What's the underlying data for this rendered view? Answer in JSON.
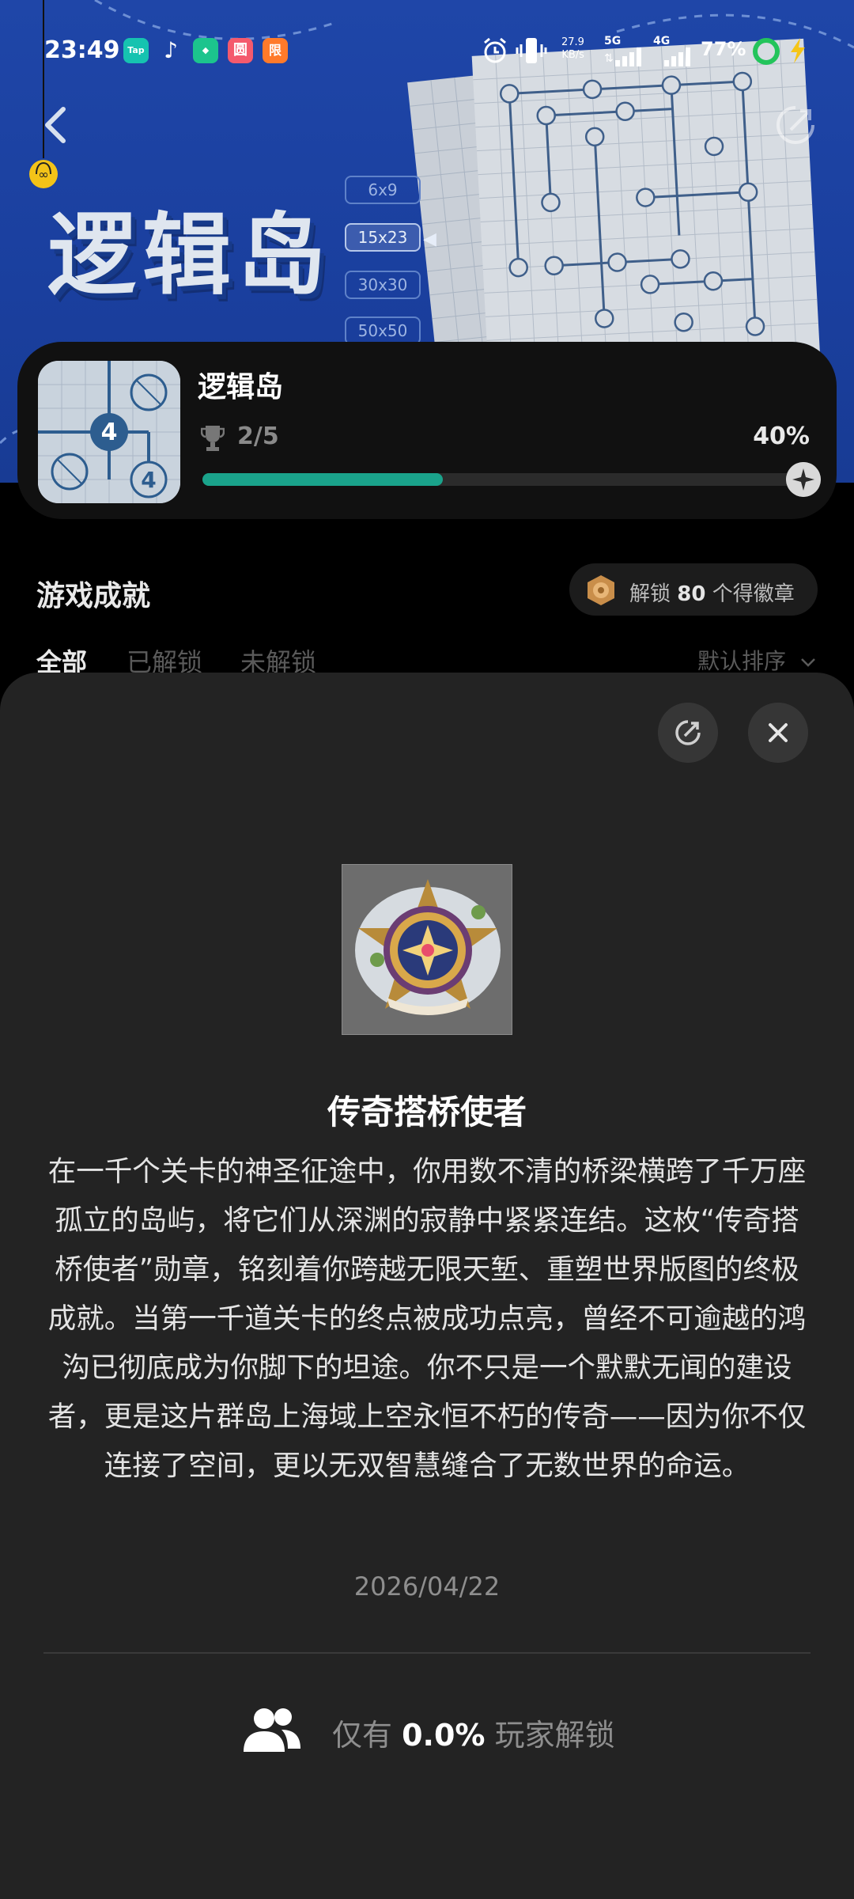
{
  "status_bar": {
    "time": "23:49",
    "apps": [
      {
        "name": "tap-app-icon",
        "label": "Tap",
        "color": "#16c3b0"
      },
      {
        "name": "tiktok-icon",
        "label": "♪",
        "color": "transparent"
      },
      {
        "name": "shield-app-icon",
        "label": "◆",
        "color": "#1cc48d"
      },
      {
        "name": "photo-app-icon",
        "label": "圆",
        "color": "#f45a6d"
      },
      {
        "name": "flash-sale-icon",
        "label": "限",
        "color": "#ff7a2a"
      }
    ],
    "net_speed_value": "27.9",
    "net_speed_unit": "KB/s",
    "sim1": "5G",
    "sim2": "4G",
    "battery": "77%"
  },
  "banner": {
    "title": "逻辑岛",
    "sizes": [
      "6x9",
      "15x23",
      "30x30",
      "50x50"
    ],
    "active_size": "15x23"
  },
  "game_card": {
    "name": "逻辑岛",
    "count": "2/5",
    "percent": "40%",
    "progress": 0.4,
    "thumb_number": "4"
  },
  "achievements": {
    "title": "游戏成就",
    "badge_pill_prefix": "解锁 ",
    "badge_pill_count": "80",
    "badge_pill_suffix": " 个得徽章",
    "tabs": [
      "全部",
      "已解锁",
      "未解锁"
    ],
    "sort_label": "默认排序"
  },
  "detail": {
    "name": "传奇搭桥使者",
    "description": "在一千个关卡的神圣征途中，你用数不清的桥梁横跨了千万座孤立的岛屿，将它们从深渊的寂静中紧紧连结。这枚“传奇搭桥使者”勋章，铭刻着你跨越无限天堑、重塑世界版图的终极成就。当第一千道关卡的终点被成功点亮，曾经不可逾越的鸿沟已彻底成为你脚下的坦途。你不只是一个默默无闻的建设者，更是这片群岛上海域上空永恒不朽的传奇——因为你不仅连接了空间，更以无双智慧缝合了无数世界的命运。",
    "date": "2026/04/22",
    "players_prefix": "仅有 ",
    "players_pct": "0.0%",
    "players_suffix": " 玩家解锁"
  },
  "colors": {
    "banner_blue": "#1f46a8",
    "progress_teal": "#1aa38b",
    "sheet_bg": "#232323"
  }
}
